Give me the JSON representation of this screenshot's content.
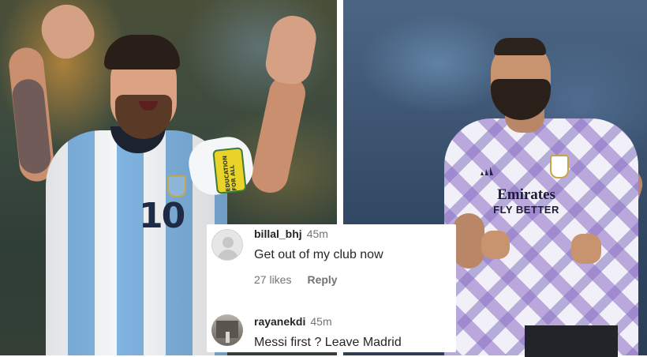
{
  "photos": {
    "left_subject": "messi-photo",
    "right_subject": "benzema-photo"
  },
  "messi": {
    "shirt_number": "10",
    "armband_text": "EDUCATION FOR ALL"
  },
  "benzema": {
    "sponsor_line1": "Emirates",
    "sponsor_line2": "FLY BETTER"
  },
  "comments": [
    {
      "username": "billal_bhj",
      "time": "45m",
      "text": "Get out of my club now",
      "likes": "27 likes",
      "reply_label": "Reply"
    },
    {
      "username": "rayanekdi",
      "time": "45m",
      "text": "Messi first ? Leave Madrid"
    }
  ],
  "colors": {
    "argentina_blue": "#7fb3e0",
    "text_primary": "#262626",
    "text_secondary": "#737373",
    "armband_yellow": "#e9d32a"
  }
}
